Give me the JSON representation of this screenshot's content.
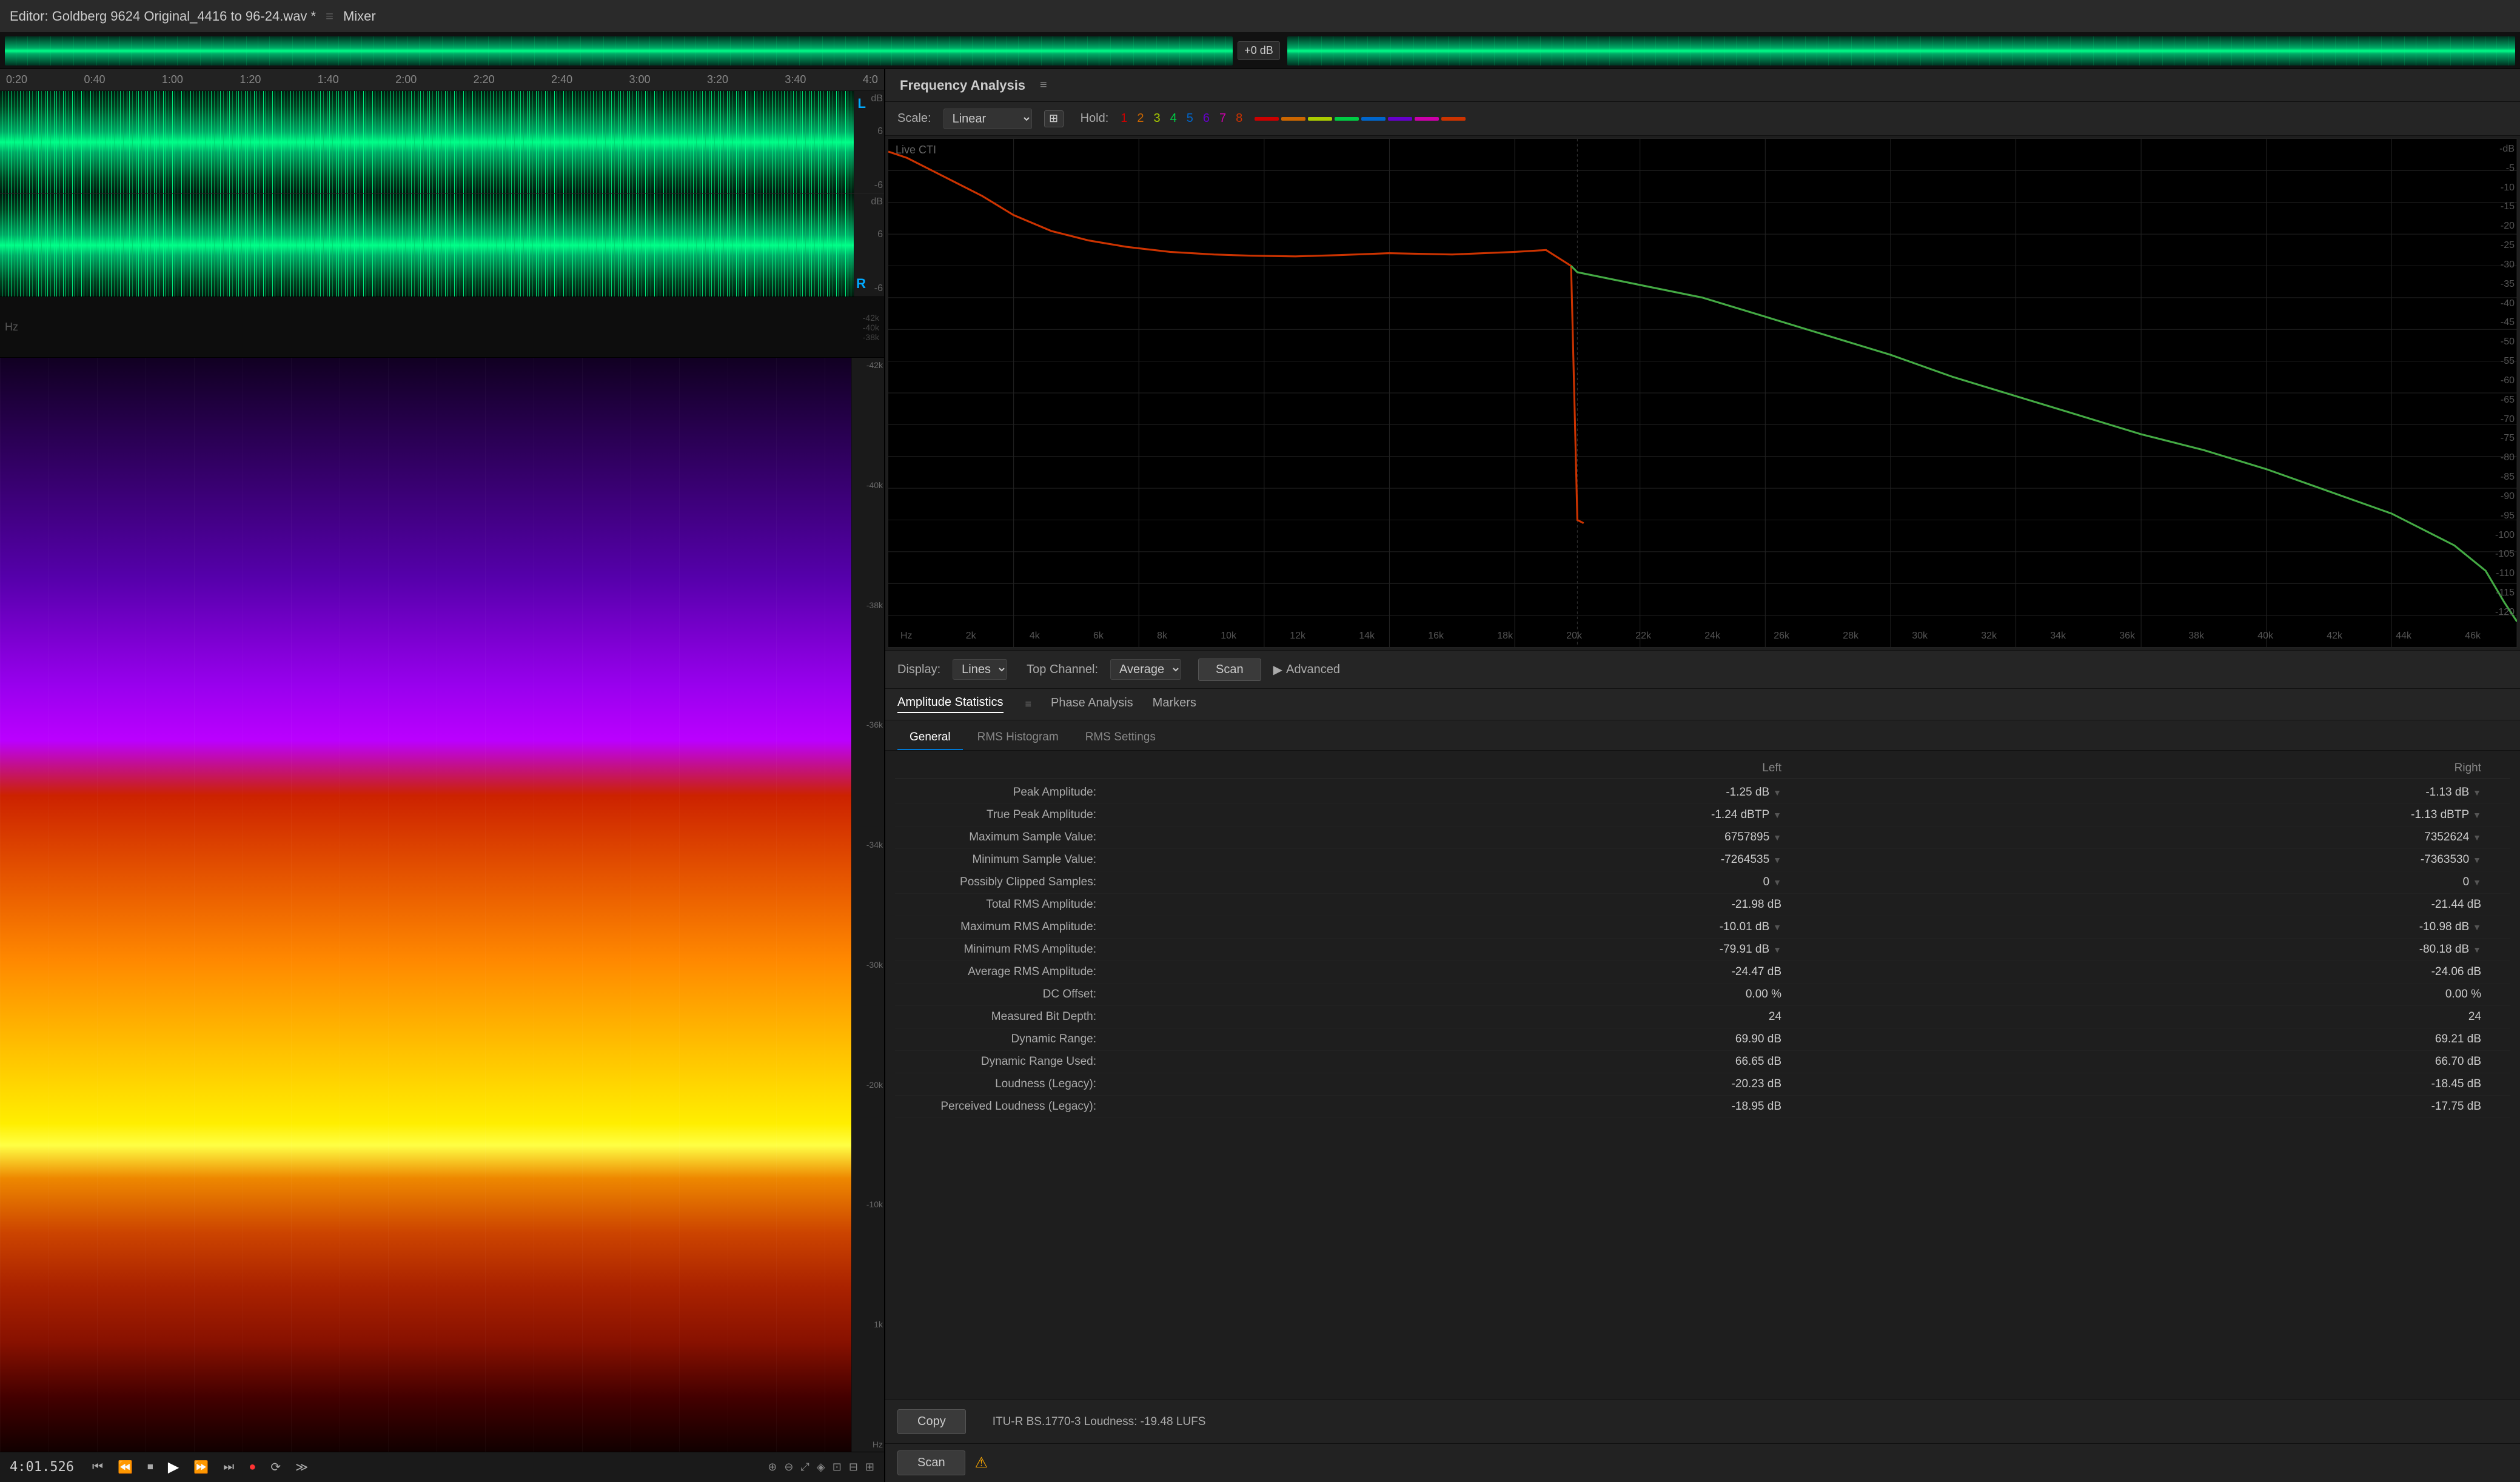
{
  "app": {
    "title": "Editor: Goldberg 9624 Original_4416 to 96-24.wav *",
    "sep": "≡",
    "mixer": "Mixer"
  },
  "overview": {
    "db_badge": "+0 dB"
  },
  "time_ruler": {
    "marks": [
      "0:20",
      "0:40",
      "1:00",
      "1:20",
      "1:40",
      "2:00",
      "2:20",
      "2:40",
      "3:00",
      "3:20",
      "3:40",
      "4:0"
    ]
  },
  "tracks": {
    "left_label": "L",
    "right_label": "R",
    "left_db": [
      "dB",
      "6",
      "-6"
    ],
    "right_db": [
      "dB",
      "6",
      "-6"
    ]
  },
  "bottom_bar": {
    "timecode": "4:01.526"
  },
  "freq_analysis": {
    "title": "Frequency Analysis",
    "menu_icon": "≡",
    "live_label": "Live CTI"
  },
  "scale_controls": {
    "scale_label": "Scale:",
    "scale_value": "Linear",
    "hold_label": "Hold:",
    "hold_numbers": [
      "1",
      "2",
      "3",
      "4",
      "5",
      "6",
      "7",
      "8"
    ],
    "hold_colors": [
      "#cc0000",
      "#cc6600",
      "#aacc00",
      "#00cc44",
      "#0066cc",
      "#6600cc",
      "#cc00aa",
      "#cc3300"
    ]
  },
  "freq_chart": {
    "live_cti_label": "Live CTI",
    "db_labels": [
      "-dB",
      "-5",
      "-10",
      "-15",
      "-20",
      "-25",
      "-30",
      "-35",
      "-40",
      "-45",
      "-50",
      "-55",
      "-60",
      "-65",
      "-70",
      "-75",
      "-80",
      "-85",
      "-90",
      "-95",
      "-100",
      "-105",
      "-110",
      "-115",
      "-120"
    ],
    "hz_labels": [
      "Hz",
      "2k",
      "4k",
      "6k",
      "8k",
      "10k",
      "12k",
      "14k",
      "16k",
      "18k",
      "20k",
      "22k",
      "24k",
      "26k",
      "28k",
      "30k",
      "32k",
      "34k",
      "36k",
      "38k",
      "40k",
      "42k",
      "44k",
      "46k"
    ]
  },
  "display_controls": {
    "display_label": "Display:",
    "display_value": "Lines",
    "top_channel_label": "Top Channel:",
    "channel_value": "Average",
    "scan_label": "Scan",
    "advanced_label": "Advanced"
  },
  "amplitude_stats": {
    "title": "Amplitude Statistics",
    "menu_icon": "≡",
    "phase_analysis_tab": "Phase Analysis",
    "markers_tab": "Markers",
    "tabs": [
      "General",
      "RMS Histogram",
      "RMS Settings"
    ],
    "active_tab": "General",
    "headers": [
      "",
      "Left",
      "Right"
    ],
    "rows": [
      {
        "label": "Peak Amplitude:",
        "left": "-1.25 dB",
        "right": "-1.13 dB",
        "left_icon": true,
        "right_icon": true
      },
      {
        "label": "True Peak Amplitude:",
        "left": "-1.24 dBTP",
        "right": "-1.13 dBTP",
        "left_icon": true,
        "right_icon": true
      },
      {
        "label": "Maximum Sample Value:",
        "left": "6757895",
        "right": "7352624",
        "left_icon": true,
        "right_icon": true
      },
      {
        "label": "Minimum Sample Value:",
        "left": "-7264535",
        "right": "-7363530",
        "left_icon": true,
        "right_icon": true
      },
      {
        "label": "Possibly Clipped Samples:",
        "left": "0",
        "right": "0",
        "left_icon": true,
        "right_icon": true
      },
      {
        "label": "Total RMS Amplitude:",
        "left": "-21.98 dB",
        "right": "-21.44 dB",
        "left_icon": false,
        "right_icon": false
      },
      {
        "label": "Maximum RMS Amplitude:",
        "left": "-10.01 dB",
        "right": "-10.98 dB",
        "left_icon": true,
        "right_icon": true
      },
      {
        "label": "Minimum RMS Amplitude:",
        "left": "-79.91 dB",
        "right": "-80.18 dB",
        "left_icon": true,
        "right_icon": true
      },
      {
        "label": "Average RMS Amplitude:",
        "left": "-24.47 dB",
        "right": "-24.06 dB",
        "left_icon": false,
        "right_icon": false
      },
      {
        "label": "DC Offset:",
        "left": "0.00 %",
        "right": "0.00 %",
        "left_icon": false,
        "right_icon": false
      },
      {
        "label": "Measured Bit Depth:",
        "left": "24",
        "right": "24",
        "left_icon": false,
        "right_icon": false
      },
      {
        "label": "Dynamic Range:",
        "left": "69.90 dB",
        "right": "69.21 dB",
        "left_icon": false,
        "right_icon": false
      },
      {
        "label": "Dynamic Range Used:",
        "left": "66.65 dB",
        "right": "66.70 dB",
        "left_icon": false,
        "right_icon": false
      },
      {
        "label": "Loudness (Legacy):",
        "left": "-20.23 dB",
        "right": "-18.45 dB",
        "left_icon": false,
        "right_icon": false
      },
      {
        "label": "Perceived Loudness (Legacy):",
        "left": "-18.95 dB",
        "right": "-17.75 dB",
        "left_icon": false,
        "right_icon": false
      }
    ],
    "copy_label": "Copy",
    "lufs_info": "ITU-R BS.1770-3 Loudness: -19.48 LUFS",
    "scan_label": "Scan",
    "warning_icon": "⚠"
  }
}
